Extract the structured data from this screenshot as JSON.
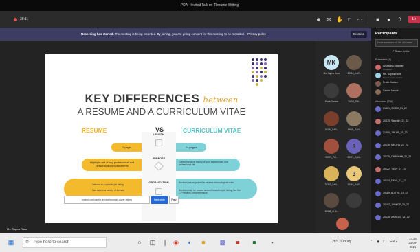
{
  "window": {
    "title": "PDA - Invited Talk on 'Resume Writing'"
  },
  "toolbar": {
    "elapsed": "38:11",
    "leave_label": "Lv"
  },
  "banner": {
    "title": "Recording has started.",
    "message": "The meeting is being recorded. By joining, you are giving consent for this meeting to be recorded.",
    "link": "Privacy policy",
    "dismiss": "Dismiss"
  },
  "slide": {
    "title": "KEY DIFFERENCES",
    "between": "between",
    "subtitle": "A RESUME AND A CURRICULUM VITAE",
    "resume_header": "RESUME",
    "vs": "VS",
    "cv_header": "CURRICULUM VITAE",
    "length_label": "LENGTH",
    "purpose_label": "PURPOSE",
    "organization_label": "ORGANIZATION",
    "resume_length": "1 page",
    "cv_length": "2+ pages",
    "resume_purpose": "Highlight set of key professional and personal accomplishments",
    "cv_purpose": "Comprehensive history of your experiences and professional life",
    "resume_org_1": "Tailored to a specific job listing",
    "resume_org_2": "Has data in a variety of formats",
    "cv_org_1": "Sections are organized in reverse chronological order",
    "cv_org_2": "Sections may be moved around based on job listing, but the CV remains comprehensive",
    "caption": "Indeed.com/career-advice/resumes-cover-letters",
    "next": "Next slide",
    "prev": "Prev",
    "presenter": "Ms. Sapna Rane"
  },
  "gallery": {
    "tiles": [
      {
        "initials": "MK",
        "name": "Ms. Sapna Rane",
        "color": "#c9e6f3"
      },
      {
        "initials": "",
        "name": "20213_KAR...",
        "color": "#6b5a4a"
      },
      {
        "initials": "",
        "name": "Pratik Gadam",
        "color": "#3b3b3b"
      },
      {
        "initials": "",
        "name": "20SAI_SHI...",
        "color": "#b07060"
      },
      {
        "initials": "",
        "name": "20SAI_KAR...",
        "color": "#7a3e2c"
      },
      {
        "initials": "",
        "name": "AHUB_SAN...",
        "color": "#8a7a62"
      },
      {
        "initials": "",
        "name": "20373_PAI...",
        "color": "#a0503c"
      },
      {
        "initials": "3",
        "name": "20374_RAN...",
        "color": "#6a62b8"
      },
      {
        "initials": "",
        "name": "20361_SAN...",
        "color": "#d8b35a"
      },
      {
        "initials": "3",
        "name": "20362_BAR...",
        "color": "#e9c87a"
      },
      {
        "initials": "",
        "name": "20348_SHA...",
        "color": "#5a4a40"
      },
      {
        "initials": "",
        "name": "",
        "color": "#3b3b3b"
      }
    ]
  },
  "panel": {
    "title": "Participants",
    "invite_placeholder": "Invite someone or dial a number",
    "share": "Share invite",
    "presenters_section": "Presenters (4)",
    "attendees_section": "Attendees (758)",
    "presenters": [
      {
        "name": "Anuradha Mokhtar",
        "role": "Organizer",
        "color": "#d06a6a"
      },
      {
        "name": "Ms. Sapna Rane",
        "role": "Pencil/mouse control",
        "color": "#9bd0e6"
      },
      {
        "name": "Pratik Gadam",
        "role": "",
        "color": "#7a5a4a"
      },
      {
        "name": "Sachin Naode",
        "role": "",
        "color": "#8c6a56"
      }
    ],
    "attendees": [
      {
        "name": "21301_SIDDH_21_22",
        "color": "#6a6ac8"
      },
      {
        "name": "20375_Sannath_21_22",
        "color": "#c46f6f"
      },
      {
        "name": "21300_JBKAR_21_22",
        "color": "#6a6ac8"
      },
      {
        "name": "20136_MEDHA_21_22",
        "color": "#6a6ac8"
      },
      {
        "name": "20135_CHAVHAN_21_22",
        "color": "#6a6ac8"
      },
      {
        "name": "20122_TAGV_21_22",
        "color": "#c46f6f"
      },
      {
        "name": "20124_DEVA_21_22",
        "color": "#6a6ac8"
      },
      {
        "name": "20119_ADITYA_21_22",
        "color": "#6a6ac8"
      },
      {
        "name": "20107_JANKDS_21_22",
        "color": "#6a6ac8"
      },
      {
        "name": "20138_AAREAS_21_22",
        "color": "#6a6ac8"
      }
    ]
  },
  "taskbar": {
    "search_placeholder": "Type here to search",
    "weather": "28°C Cloudy",
    "language": "ENG",
    "time": "14:25",
    "date": "23-09-2021"
  },
  "colors": {
    "accent": "#6264a7",
    "resume_yellow": "#f4ba2e",
    "cv_teal": "#7fd1d8",
    "leave_red": "#c4314b"
  }
}
